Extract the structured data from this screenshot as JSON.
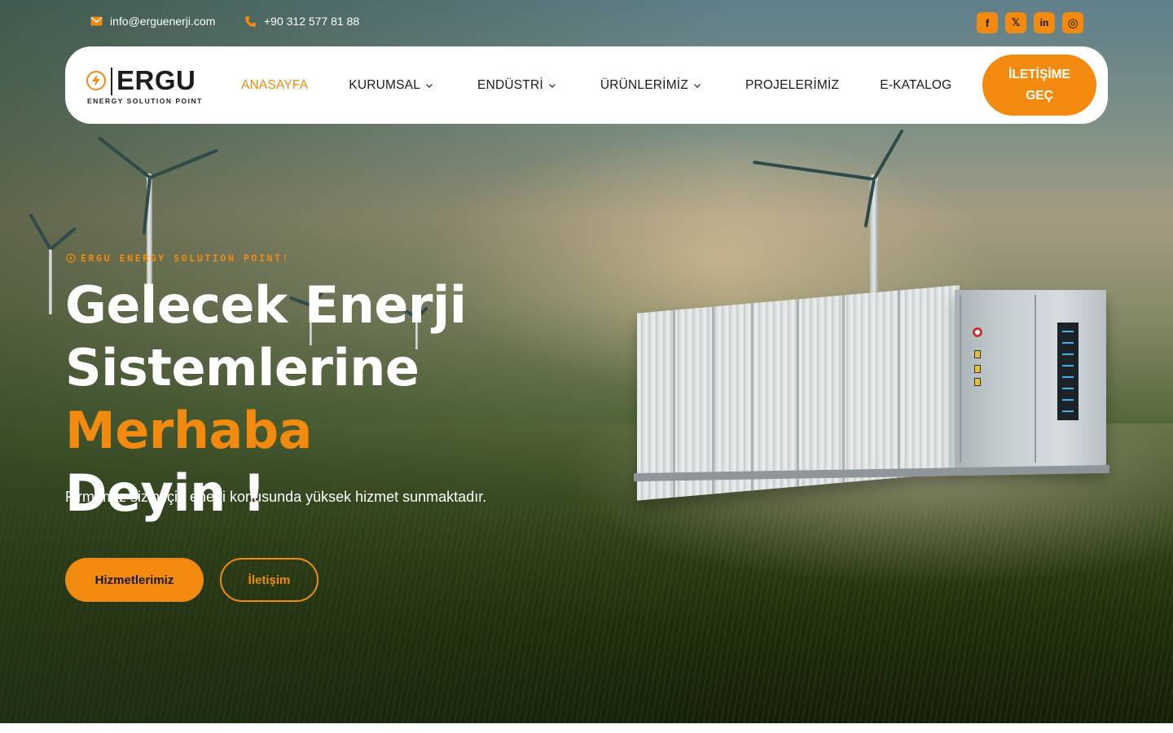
{
  "topbar": {
    "email": "info@erguenerji.com",
    "phone": "+90 312 577 81 88",
    "socials": [
      {
        "icon": "facebook-icon",
        "glyph": "f"
      },
      {
        "icon": "x-icon",
        "glyph": "𝕏"
      },
      {
        "icon": "linkedin-icon",
        "glyph": "in"
      },
      {
        "icon": "instagram-icon",
        "glyph": "◎"
      }
    ]
  },
  "brand": {
    "name": "ERGU",
    "tagline": "ENERGY SOLUTION POINT"
  },
  "nav": {
    "items": [
      {
        "label": "ANASAYFA",
        "active": true,
        "dropdown": false
      },
      {
        "label": "KURUMSAL",
        "active": false,
        "dropdown": true
      },
      {
        "label": "ENDÜSTRİ",
        "active": false,
        "dropdown": true
      },
      {
        "label": "ÜRÜNLERİMİZ",
        "active": false,
        "dropdown": true
      },
      {
        "label": "PROJELERİMİZ",
        "active": false,
        "dropdown": false
      },
      {
        "label": "E-KATALOG",
        "active": false,
        "dropdown": false
      }
    ],
    "cta": "İLETİŞİME GEÇ"
  },
  "hero": {
    "eyebrow": "ERGU ENERGY SOLUTION POINT!",
    "headline_line1": "Gelecek Enerji",
    "headline_line2_a": "Sistemlerine ",
    "headline_accent": "Merhaba",
    "headline_line3": "Deyin !",
    "subtitle": "Firmamız sizin için enerji konusunda yüksek hizmet sunmaktadır.",
    "primary_button": "Hizmetlerimiz",
    "secondary_button": "İletişim"
  },
  "colors": {
    "accent": "#f28a0f",
    "text_dark": "#1b1b1b",
    "white": "#ffffff"
  }
}
